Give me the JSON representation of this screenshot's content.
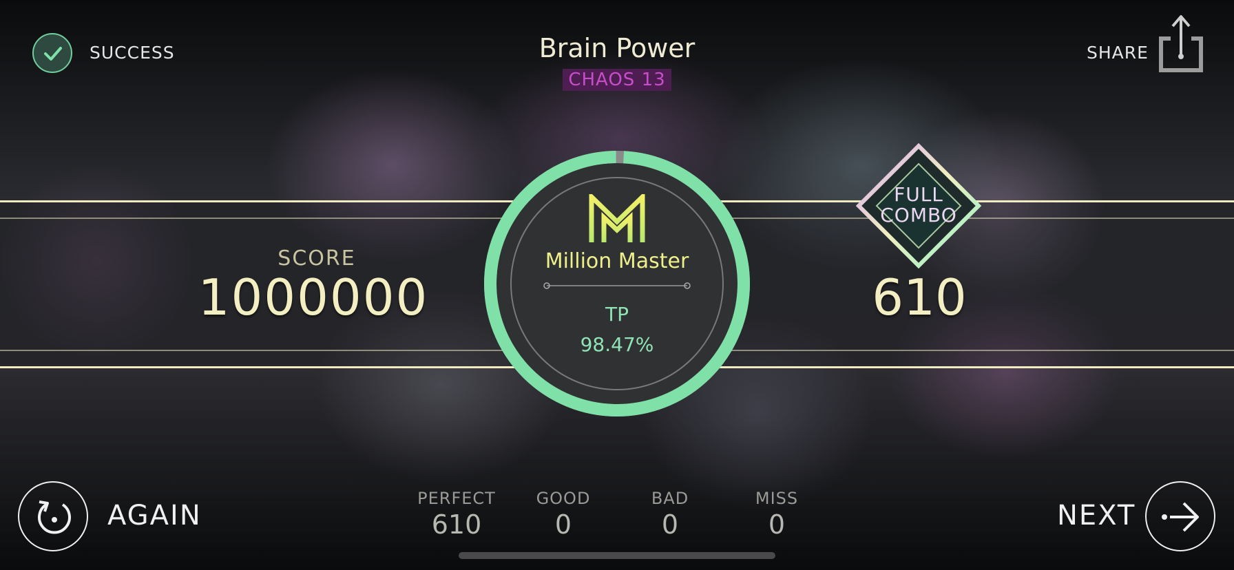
{
  "status": {
    "label": "SUCCESS",
    "icon": "check-icon"
  },
  "song": {
    "title": "Brain Power",
    "difficulty": "CHAOS 13"
  },
  "share": {
    "label": "SHARE",
    "icon": "share-icon"
  },
  "score": {
    "label": "SCORE",
    "value": "1000000"
  },
  "rank": {
    "name": "Million Master",
    "tp_label": "TP",
    "tp_value": "98.47%",
    "ring_fill": 0.99
  },
  "combo": {
    "badge_line1": "FULL",
    "badge_line2": "COMBO",
    "value": "610"
  },
  "judgements": [
    {
      "label": "PERFECT",
      "value": "610"
    },
    {
      "label": "GOOD",
      "value": "0"
    },
    {
      "label": "BAD",
      "value": "0"
    },
    {
      "label": "MISS",
      "value": "0"
    }
  ],
  "actions": {
    "again_label": "AGAIN",
    "next_label": "NEXT"
  },
  "colors": {
    "accent_green": "#7fe0a8",
    "score_yellow": "#f3efc3",
    "chaos_purple": "#c74ec9"
  }
}
